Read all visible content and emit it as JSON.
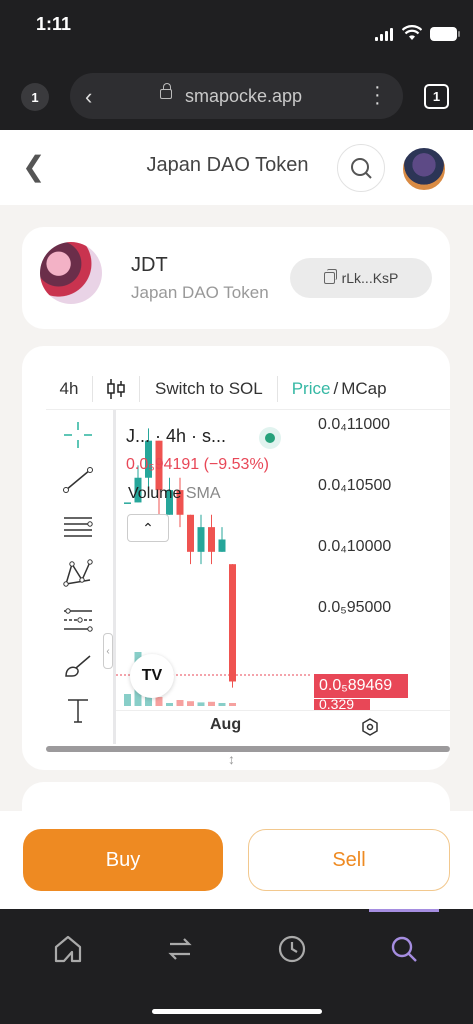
{
  "status_bar": {
    "time": "1:11"
  },
  "browser": {
    "tab_count_left": "1",
    "url": "smapocke.app",
    "tab_count_right": "1"
  },
  "header": {
    "title": "Japan DAO Token"
  },
  "token": {
    "symbol": "JDT",
    "name": "Japan DAO Token",
    "address_short": "rLk...KsP"
  },
  "chart_toolbar": {
    "interval": "4h",
    "switch_label": "Switch to SOL",
    "price_tab": "Price",
    "separator": "/",
    "mcap_tab": "MCap"
  },
  "chart_legend": {
    "title": "J... · 4h · s...",
    "price": "0.0₅94191 (−9.53%)",
    "volume_label": "Volume",
    "volume_indicator": "SMA"
  },
  "chart_data": {
    "type": "candlestick",
    "y_axis_labels": [
      "0.0₄11000",
      "0.0₄10500",
      "0.0₄10000",
      "0.0₅95000"
    ],
    "last_price_label": "0.0₅89469",
    "last_volume_label": "0.329",
    "x_axis_labels": [
      "Aug"
    ],
    "ylim": [
      8.8e-06,
      1.11e-05
    ],
    "candles": [
      {
        "open": 1.04e-05,
        "close": 1.04e-05,
        "high": 1.04e-05,
        "low": 1.04e-05
      },
      {
        "open": 1.04e-05,
        "close": 1.06e-05,
        "high": 1.07e-05,
        "low": 1.04e-05
      },
      {
        "open": 1.06e-05,
        "close": 1.09e-05,
        "high": 1.1e-05,
        "low": 1.05e-05
      },
      {
        "open": 1.09e-05,
        "close": 1.05e-05,
        "high": 1.09e-05,
        "low": 1.03e-05
      },
      {
        "open": 1.03e-05,
        "close": 1.05e-05,
        "high": 1.06e-05,
        "low": 1.03e-05
      },
      {
        "open": 1.05e-05,
        "close": 1.03e-05,
        "high": 1.06e-05,
        "low": 1.02e-05
      },
      {
        "open": 1.03e-05,
        "close": 1e-05,
        "high": 1.03e-05,
        "low": 9.9e-06
      },
      {
        "open": 1e-05,
        "close": 1.02e-05,
        "high": 1.03e-05,
        "low": 9.9e-06
      },
      {
        "open": 1.02e-05,
        "close": 1e-05,
        "high": 1.03e-05,
        "low": 9.9e-06
      },
      {
        "open": 1e-05,
        "close": 1.01e-05,
        "high": 1.02e-05,
        "low": 1e-05
      },
      {
        "open": 9.9e-06,
        "close": 8.95e-06,
        "high": 9.9e-06,
        "low": 8.9e-06
      }
    ],
    "volume_bars": [
      0.2,
      0.9,
      0.3,
      0.15,
      0.05,
      0.1,
      0.08,
      0.06,
      0.07,
      0.05,
      0.05
    ],
    "colors": {
      "up": "#26a69a",
      "down": "#ef5350"
    }
  },
  "actions": {
    "buy_label": "Buy",
    "sell_label": "Sell"
  },
  "nav": {
    "items": [
      "home-icon",
      "swap-icon",
      "history-icon",
      "search-icon"
    ],
    "active": "search-icon",
    "accent": "#a58de0"
  },
  "brand_colors": {
    "primary": "#ee8a22",
    "price_up": "#35b8a4",
    "price_down": "#e84757"
  }
}
